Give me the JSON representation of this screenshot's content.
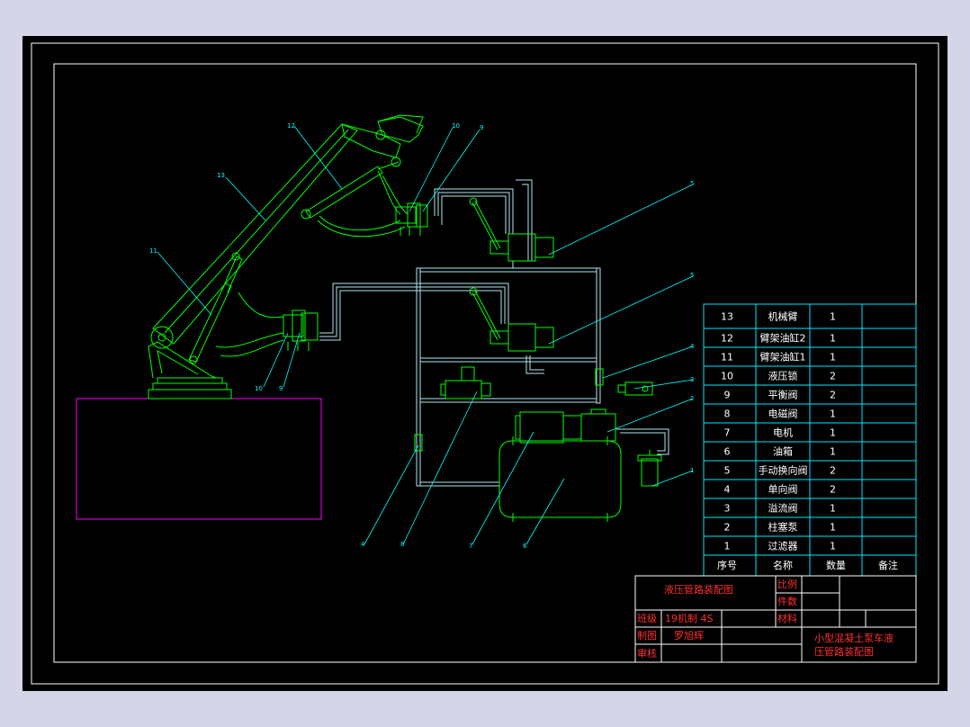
{
  "colors": {
    "background": "#000000",
    "border": "#ffffff",
    "machine": "#00ff00",
    "pipes": "#aee8f0",
    "leaders": "#00ffff",
    "table_lines": "#00e5ff",
    "table_text": "#ffffff",
    "title_text": "#ff3030",
    "base_box": "#ff00ff",
    "window_bg": "#d4d5e6"
  },
  "callouts": {
    "c13": "13",
    "c12": "12",
    "c11": "11",
    "c10_top": "10",
    "c9_top": "9",
    "c5_top": "5",
    "c5_mid": "5",
    "c4": "4",
    "c3": "3",
    "c2": "2",
    "c1": "1",
    "c10_bot": "10",
    "c9_bot": "9",
    "c4_bot": "4",
    "c8": "8",
    "c7": "7",
    "c6": "6"
  },
  "parts_list": {
    "rows": [
      {
        "no": "13",
        "name": "机械臂",
        "qty": "1"
      },
      {
        "no": "12",
        "name": "臂架油缸2",
        "qty": "1"
      },
      {
        "no": "11",
        "name": "臂架油缸1",
        "qty": "1"
      },
      {
        "no": "10",
        "name": "液压锁",
        "qty": "2"
      },
      {
        "no": "9",
        "name": "平衡阀",
        "qty": "2"
      },
      {
        "no": "8",
        "name": "电磁阀",
        "qty": "1"
      },
      {
        "no": "7",
        "name": "电机",
        "qty": "1"
      },
      {
        "no": "6",
        "name": "油箱",
        "qty": "1"
      },
      {
        "no": "5",
        "name": "手动换向阀",
        "qty": "2"
      },
      {
        "no": "4",
        "name": "单向阀",
        "qty": "2"
      },
      {
        "no": "3",
        "name": "溢流阀",
        "qty": "1"
      },
      {
        "no": "2",
        "name": "柱塞泵",
        "qty": "1"
      },
      {
        "no": "1",
        "name": "过滤器",
        "qty": "1"
      }
    ],
    "header": {
      "no": "序号",
      "name": "名称",
      "qty": "数量",
      "remark": "备注"
    }
  },
  "title_block": {
    "drawing_title": "液压管路装配图",
    "scale_label": "比例",
    "count_label": "件数",
    "material_label": "材料",
    "class_label": "班级",
    "class_value": "19机制 4S",
    "drawn_label": "制图",
    "drawn_value": "罗旭辉",
    "review_label": "审核",
    "project_line1": "小型混凝土泵车液",
    "project_line2": "压管路装配图"
  }
}
